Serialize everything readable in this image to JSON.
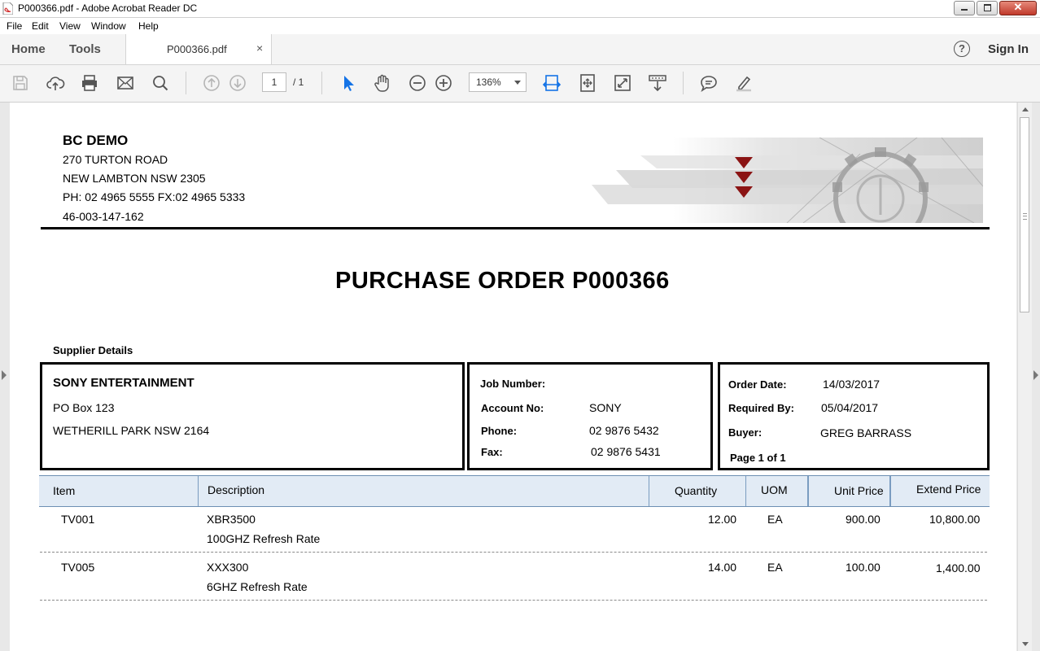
{
  "window": {
    "title": "P000366.pdf - Adobe Acrobat Reader DC"
  },
  "menu": [
    "File",
    "Edit",
    "View",
    "Window",
    "Help"
  ],
  "tabs": {
    "home": "Home",
    "tools": "Tools",
    "document": "P000366.pdf",
    "close": "×",
    "help": "?",
    "sign_in": "Sign In"
  },
  "toolbar": {
    "page_current": "1",
    "page_total": "/ 1",
    "zoom": "136%",
    "active_tool_color": "#1473e6",
    "icons": [
      "save-icon",
      "upload-icon",
      "print-icon",
      "email-icon",
      "search-icon",
      "page-up-icon",
      "page-down-icon",
      "select-cursor-icon",
      "hand-icon",
      "zoom-out-icon",
      "zoom-in-icon",
      "fit-width-icon",
      "fit-page-icon",
      "full-screen-icon",
      "scroll-mode-icon",
      "comment-icon",
      "highlight-icon"
    ]
  },
  "document": {
    "company": {
      "name": "BC DEMO",
      "address1": "270 TURTON ROAD",
      "address2": "NEW LAMBTON NSW  2305",
      "phone": "PH: 02  4965 5555 FX:02 4965 5333",
      "abn": "46-003-147-162"
    },
    "title": "PURCHASE ORDER  P000366",
    "supplier_label": "Supplier Details",
    "supplier": {
      "name": "SONY ENTERTAINMENT",
      "address1": "PO Box 123",
      "address2": "WETHERILL PARK  NSW 2164"
    },
    "job": {
      "job_number_label": "Job Number:",
      "job_number": "",
      "account_label": "Account No:",
      "account": "SONY",
      "phone_label": "Phone:",
      "phone": "02 9876 5432",
      "fax_label": "Fax:",
      "fax": "02 9876 5431"
    },
    "order": {
      "order_date_label": "Order Date:",
      "order_date": "14/03/2017",
      "required_label": "Required By:",
      "required": "05/04/2017",
      "buyer_label": "Buyer:",
      "buyer": "GREG BARRASS",
      "page": "Page 1 of 1"
    },
    "table": {
      "headers": [
        "Item",
        "Description",
        "Quantity",
        "UOM",
        "Unit Price",
        "Extend Price"
      ],
      "rows": [
        {
          "item": "TV001",
          "desc1": "XBR3500",
          "desc2": "100GHZ Refresh Rate",
          "qty": "12.00",
          "uom": "EA",
          "unit": "900.00",
          "extend": "10,800.00"
        },
        {
          "item": "TV005",
          "desc1": "XXX300",
          "desc2": "6GHZ Refresh Rate",
          "qty": "14.00",
          "uom": "EA",
          "unit": "100.00",
          "extend": "1,400.00"
        }
      ]
    }
  }
}
